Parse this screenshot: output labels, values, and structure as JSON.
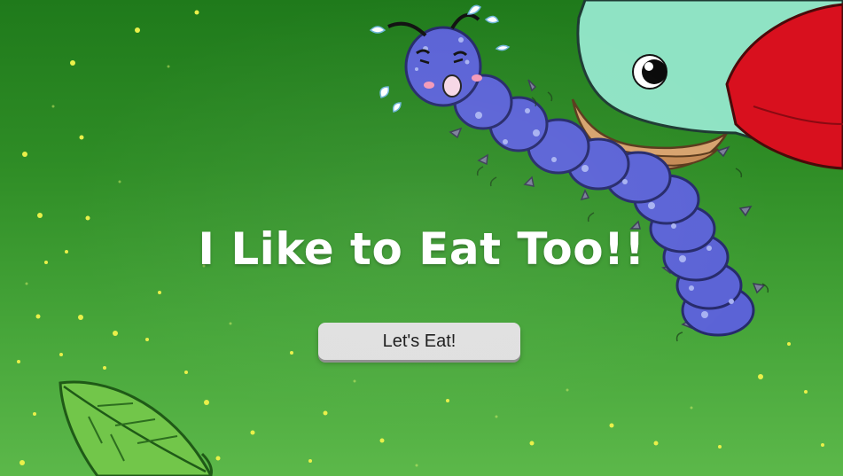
{
  "title": "I Like to Eat Too!!",
  "play_button": {
    "label": "Let's Eat!"
  },
  "colors": {
    "bg_top": "#1f7a1b",
    "bg_bottom": "#5cb84a",
    "bird_body": "#8fe3c4",
    "bird_wing": "#d8101e",
    "caterpillar": "#5b63d6",
    "firefly": "#e9f04a",
    "leaf": "#72c64a"
  },
  "icons": {
    "bird": "bird-icon",
    "caterpillar": "caterpillar-icon",
    "leaf": "leaf-icon",
    "fireflies": "firefly-dots"
  }
}
